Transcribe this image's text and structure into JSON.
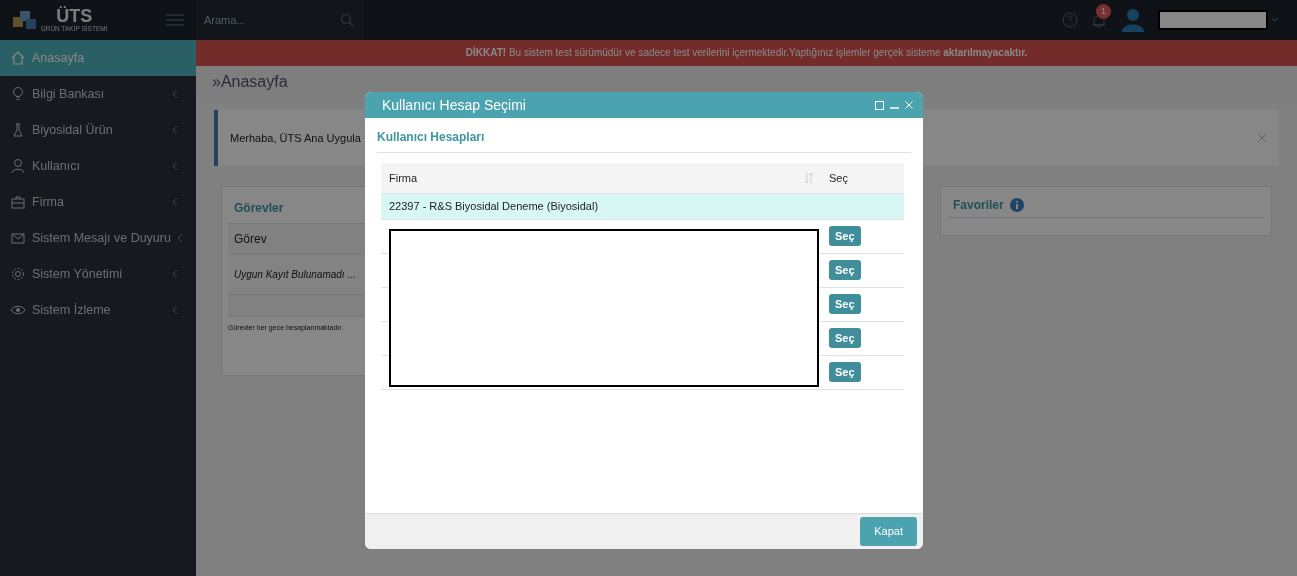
{
  "header": {
    "logo": {
      "title": "ÜTS",
      "subtitle": "ÜRÜN TAKİP SİSTEMİ"
    },
    "search": {
      "placeholder": "Arama..."
    },
    "notifications": {
      "count": "1"
    },
    "user": {
      "redacted": true
    }
  },
  "sidebar": {
    "items": [
      {
        "label": "Anasayfa",
        "kind": "home",
        "selected": true,
        "expandable": false
      },
      {
        "label": "Bilgi Bankası",
        "kind": "bulb",
        "selected": false,
        "expandable": true
      },
      {
        "label": "Biyosidal Ürün",
        "kind": "flask",
        "selected": false,
        "expandable": true
      },
      {
        "label": "Kullanıcı",
        "kind": "user",
        "selected": false,
        "expandable": true
      },
      {
        "label": "Firma",
        "kind": "briefcase",
        "selected": false,
        "expandable": true
      },
      {
        "label": "Sistem Mesajı ve Duyuru",
        "kind": "mail",
        "selected": false,
        "expandable": true
      },
      {
        "label": "Sistem Yönetimi",
        "kind": "gear",
        "selected": false,
        "expandable": true
      },
      {
        "label": "Sistem İzleme",
        "kind": "eye",
        "selected": false,
        "expandable": true
      }
    ]
  },
  "banner": "**DİKKAT!** Bu sistem test sürümüdür ve sadece test verilerini içermektedir.Yaptığınız işlemler gerçek sisteme **aktarılmayacaktır.**",
  "breadcrumb": "»Anasayfa",
  "welcome": "Merhaba, ÜTS Ana Uygula",
  "tasks": {
    "title": "Görevler",
    "column": "Görev",
    "empty": "Uygun Kayıt Bulunamadı ...",
    "note": "Görevler her gece hesaplanmaktadır."
  },
  "favorites": {
    "title": "Favoriler"
  },
  "modal": {
    "title": "Kullanıcı Hesap Seçimi",
    "subtitle": "Kullanıcı Hesapları",
    "columns": [
      "Firma",
      "Seç"
    ],
    "rows": [
      {
        "firma": "22397 - R&S Biyosidal Deneme (Biyosidal)",
        "selected": true
      },
      {
        "redacted": true,
        "selected": false,
        "button": "Seç"
      },
      {
        "redacted": true,
        "selected": false,
        "button": "Seç"
      },
      {
        "redacted": true,
        "selected": false,
        "button": "Seç"
      },
      {
        "redacted": true,
        "selected": false,
        "button": "Seç"
      },
      {
        "redacted": true,
        "selected": false,
        "button": "Seç"
      }
    ],
    "close_button": "Kapat"
  }
}
